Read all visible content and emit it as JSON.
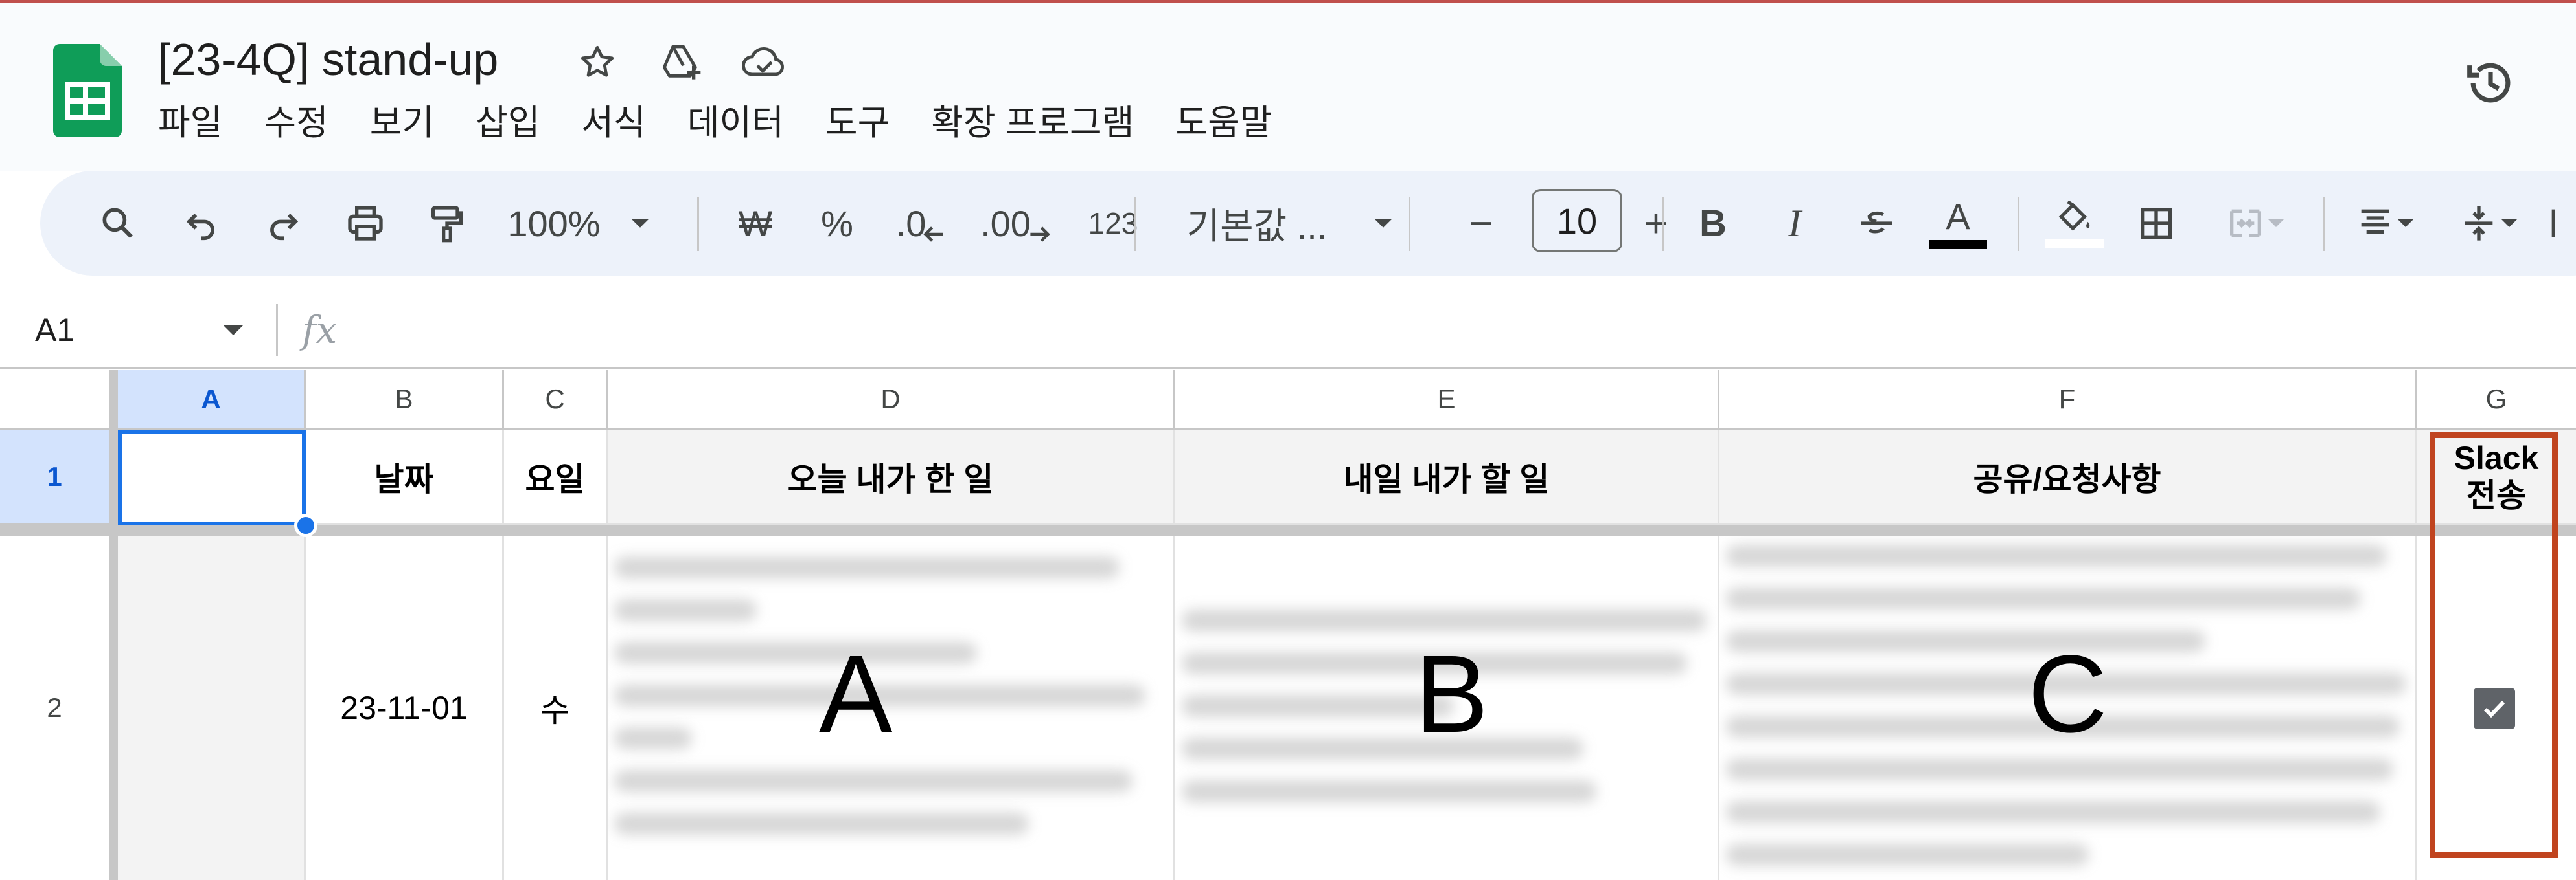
{
  "document": {
    "title": "[23-4Q] stand-up"
  },
  "menu": [
    "파일",
    "수정",
    "보기",
    "삽입",
    "서식",
    "데이터",
    "도구",
    "확장 프로그램",
    "도움말"
  ],
  "toolbar": {
    "zoom": "100%",
    "currency": "₩",
    "percent": "%",
    "decrease_decimal": ".0",
    "increase_decimal": ".00",
    "number_format": "123",
    "font": "기본값 ...",
    "font_size": "10",
    "minus": "−",
    "plus": "+",
    "bold": "B",
    "italic": "I",
    "text_color_letter": "A",
    "text_color_bar": "#000000",
    "fill_color_bar": "#ffffff"
  },
  "formula_bar": {
    "name_box": "A1",
    "fx": "fx"
  },
  "columns": [
    "A",
    "B",
    "C",
    "D",
    "E",
    "F",
    "G"
  ],
  "rows": [
    "1",
    "2"
  ],
  "header_row": {
    "A": "",
    "B": "날짜",
    "C": "요일",
    "D": "오늘 내가 한 일",
    "E": "내일 내가 할 일",
    "F": "공유/요청사항",
    "G_line1": "Slack",
    "G_line2": "전송"
  },
  "data_row": {
    "B": "23-11-01",
    "C": "수",
    "D_label": "A",
    "E_label": "B",
    "F_label": "C",
    "G_checked": true
  },
  "colors": {
    "selection": "#1a73e8",
    "annotation": "#c0441f",
    "toolbar_bg": "#edf2fa",
    "sheets_green": "#0f9d58"
  }
}
